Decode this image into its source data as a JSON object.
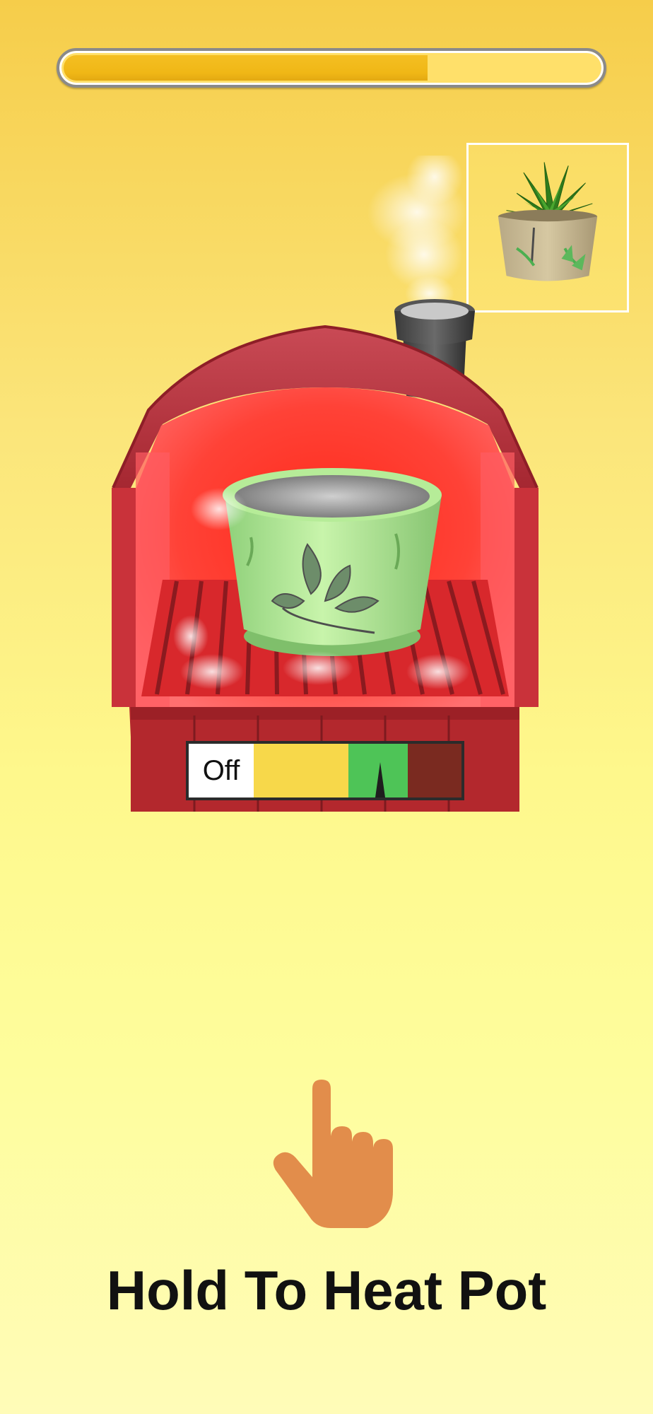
{
  "level_progress": {
    "fraction": 0.68,
    "fill_color": "#f2bb1a",
    "track_color": "#ffe06a"
  },
  "target_preview": {
    "description_icon": "succulent-in-pot-icon"
  },
  "kiln": {
    "body_color": "#b8252c",
    "interior_color": "#ff3b3b",
    "pot_color": "#a8e68c",
    "chimney_icon": "chimney-icon",
    "steam_icon": "steam-icon"
  },
  "heat_gauge": {
    "off_label": "Off",
    "zones": [
      "off",
      "warm",
      "ideal",
      "overheat"
    ],
    "zone_colors": {
      "off": "#ffffff",
      "warm": "#f7d84a",
      "ideal": "#4ec457",
      "overheat": "#7a2a20"
    },
    "needle_zone": "ideal"
  },
  "hand_icon": "tap-hand-icon",
  "instruction_text": "Hold To Heat Pot"
}
